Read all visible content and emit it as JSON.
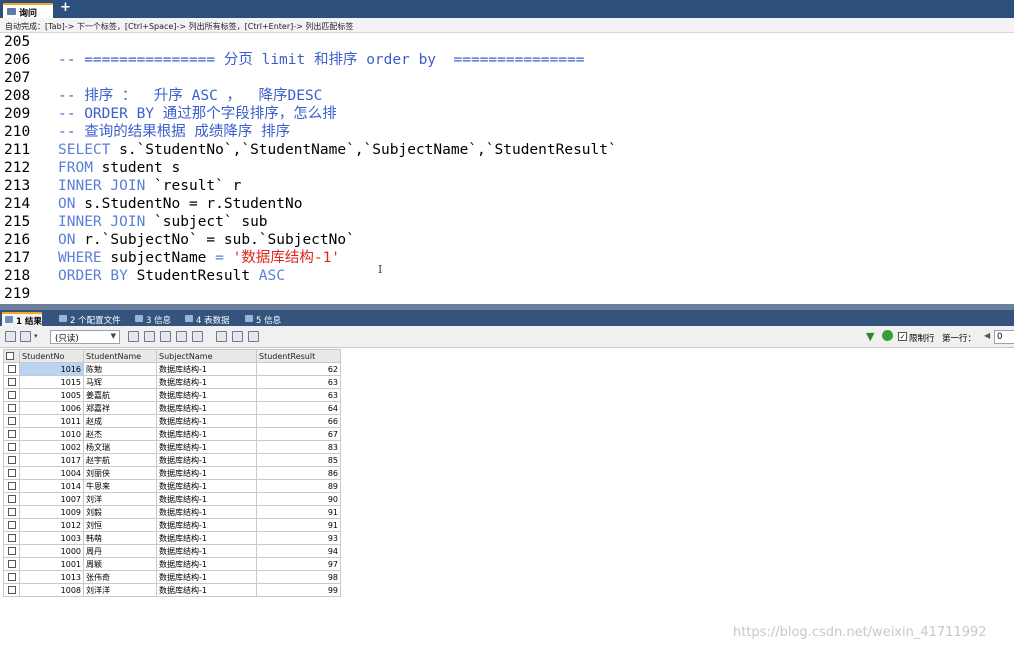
{
  "query_tab": {
    "label": "询问",
    "add_label": "+"
  },
  "hint": "自动完成：[Tab]-> 下一个标签，[Ctrl+Space]-> 列出所有标签，[Ctrl+Enter]-> 列出匹配标签",
  "editor": {
    "lines": [
      {
        "no": "205",
        "parts": []
      },
      {
        "no": "206",
        "parts": [
          {
            "t": "-- =============== 分页 limit 和排序 order by  ===============",
            "c": "comment"
          }
        ]
      },
      {
        "no": "207",
        "parts": []
      },
      {
        "no": "208",
        "parts": [
          {
            "t": "-- 排序 ：  升序 ASC ，  降序DESC",
            "c": "comment"
          }
        ]
      },
      {
        "no": "209",
        "parts": [
          {
            "t": "-- ORDER BY 通过那个字段排序，怎么排",
            "c": "comment"
          }
        ]
      },
      {
        "no": "210",
        "parts": [
          {
            "t": "-- 查询的结果根据 成绩降序 排序",
            "c": "comment"
          }
        ]
      },
      {
        "no": "211",
        "parts": [
          {
            "t": "SELECT",
            "c": "kw"
          },
          {
            "t": " s.`StudentNo`,`StudentName`,`SubjectName`,`StudentResult`",
            "c": "id"
          }
        ]
      },
      {
        "no": "212",
        "parts": [
          {
            "t": "FROM",
            "c": "kw"
          },
          {
            "t": " student s",
            "c": "id"
          }
        ]
      },
      {
        "no": "213",
        "parts": [
          {
            "t": "INNER JOIN",
            "c": "kw"
          },
          {
            "t": " `result` r",
            "c": "id"
          }
        ]
      },
      {
        "no": "214",
        "parts": [
          {
            "t": "ON",
            "c": "kw"
          },
          {
            "t": " s.StudentNo = r.StudentNo",
            "c": "id"
          }
        ]
      },
      {
        "no": "215",
        "parts": [
          {
            "t": "INNER JOIN",
            "c": "kw"
          },
          {
            "t": " `subject` sub",
            "c": "id"
          }
        ]
      },
      {
        "no": "216",
        "parts": [
          {
            "t": "ON",
            "c": "kw"
          },
          {
            "t": " r.`SubjectNo` = sub.`SubjectNo`",
            "c": "id"
          }
        ]
      },
      {
        "no": "217",
        "parts": [
          {
            "t": "WHERE",
            "c": "kw"
          },
          {
            "t": " subjectName ",
            "c": "id"
          },
          {
            "t": "=",
            "c": "kw"
          },
          {
            "t": " '数据库结构-1'",
            "c": "str"
          }
        ]
      },
      {
        "no": "218",
        "parts": [
          {
            "t": "ORDER BY",
            "c": "kw"
          },
          {
            "t": " StudentResult ",
            "c": "id"
          },
          {
            "t": "ASC",
            "c": "kw"
          }
        ]
      },
      {
        "no": "219",
        "parts": []
      }
    ]
  },
  "result_tabs": [
    {
      "label": "1 结果",
      "active": true
    },
    {
      "label": "2 个配置文件",
      "active": false
    },
    {
      "label": "3 信息",
      "active": false
    },
    {
      "label": "4 表数据",
      "active": false
    },
    {
      "label": "5 信息",
      "active": false
    }
  ],
  "toolbar": {
    "readonly_label": "(只读)",
    "limit_label": "限制行",
    "first_row_label": "第一行：",
    "first_row_value": "0"
  },
  "grid": {
    "columns": [
      "StudentNo",
      "StudentName",
      "SubjectName",
      "StudentResult"
    ],
    "rows": [
      [
        "1016",
        "陈勉",
        "数据库结构-1",
        "62"
      ],
      [
        "1015",
        "马辉",
        "数据库结构-1",
        "63"
      ],
      [
        "1005",
        "姜嘉航",
        "数据库结构-1",
        "63"
      ],
      [
        "1006",
        "郑嘉祥",
        "数据库结构-1",
        "64"
      ],
      [
        "1011",
        "赵成",
        "数据库结构-1",
        "66"
      ],
      [
        "1010",
        "赵杰",
        "数据库结构-1",
        "67"
      ],
      [
        "1002",
        "杨文瑞",
        "数据库结构-1",
        "83"
      ],
      [
        "1017",
        "赵宇航",
        "数据库结构-1",
        "85"
      ],
      [
        "1004",
        "刘丽侠",
        "数据库结构-1",
        "86"
      ],
      [
        "1014",
        "牛恩来",
        "数据库结构-1",
        "89"
      ],
      [
        "1007",
        "刘洋",
        "数据库结构-1",
        "90"
      ],
      [
        "1009",
        "刘毅",
        "数据库结构-1",
        "91"
      ],
      [
        "1012",
        "刘恒",
        "数据库结构-1",
        "91"
      ],
      [
        "1003",
        "韩萌",
        "数据库结构-1",
        "93"
      ],
      [
        "1000",
        "周丹",
        "数据库结构-1",
        "94"
      ],
      [
        "1001",
        "周颖",
        "数据库结构-1",
        "97"
      ],
      [
        "1013",
        "张伟奇",
        "数据库结构-1",
        "98"
      ],
      [
        "1008",
        "刘洋洋",
        "数据库结构-1",
        "99"
      ]
    ]
  },
  "watermark": "https://blog.csdn.net/weixin_41711992"
}
